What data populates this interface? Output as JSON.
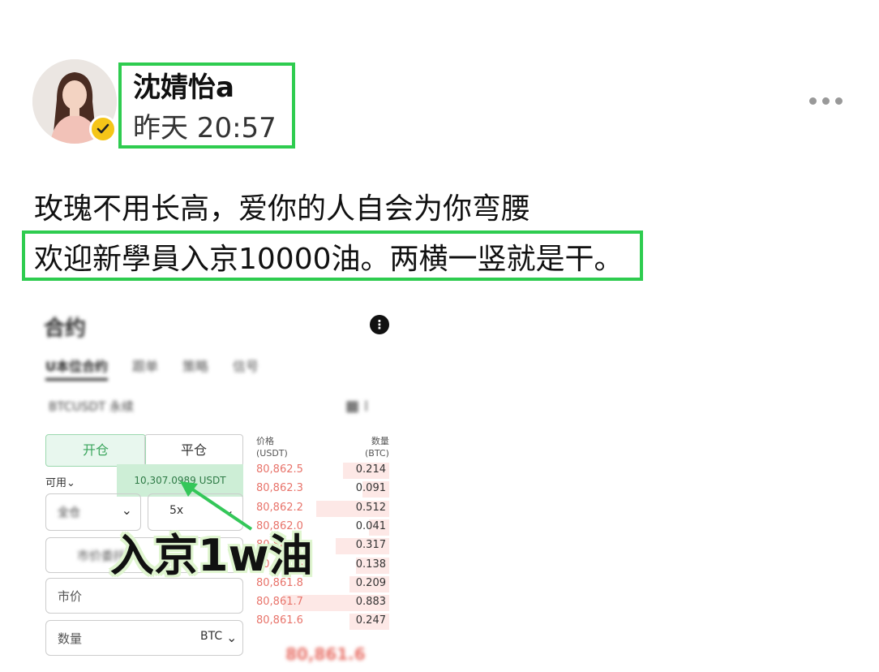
{
  "post": {
    "author": "沈婧怡a",
    "timestamp": "昨天 20:57",
    "line1": "玫瑰不用长高，爱你的人自会为你弯腰",
    "line2": "欢迎新學員入京10000油。两横一竖就是干。"
  },
  "screenshot": {
    "title": "合约",
    "tabs": [
      "U本位合约",
      "跟单",
      "策略",
      "信号"
    ],
    "pair": "BTCUSDT 永续",
    "open_label": "开仓",
    "close_label": "平仓",
    "available_label": "可用",
    "balance": "10,307.0989 USDT",
    "mode_label": "全仓",
    "leverage": "5x",
    "order_type": "市价委托",
    "market_placeholder": "市价",
    "qty_placeholder": "数量",
    "qty_unit": "BTC",
    "ob_price_header": "价格\n(USDT)",
    "ob_qty_header": "数量\n(BTC)",
    "orderbook": [
      {
        "price": "80,862.5",
        "qty": "0.214",
        "depth": 0.35
      },
      {
        "price": "80,862.3",
        "qty": "0.091",
        "depth": 0.2
      },
      {
        "price": "80,862.2",
        "qty": "0.512",
        "depth": 0.55
      },
      {
        "price": "80,862.0",
        "qty": "0.041",
        "depth": 0.15
      },
      {
        "price": "80,861.9",
        "qty": "0.317",
        "depth": 0.4
      },
      {
        "price": "80,861.8",
        "qty": "0.138",
        "depth": 0.25
      },
      {
        "price": "80,861.8",
        "qty": "0.209",
        "depth": 0.3
      },
      {
        "price": "80,861.7",
        "qty": "0.883",
        "depth": 0.8
      },
      {
        "price": "80,861.6",
        "qty": "0.247",
        "depth": 0.3
      }
    ],
    "last_price": "80,861.6",
    "overlay_text": "入京1w油"
  },
  "colors": {
    "highlight_border": "#2ecc4f",
    "verified_badge": "#f5c518",
    "ask_price": "#e8736a",
    "open_button": "#3aa55c"
  }
}
